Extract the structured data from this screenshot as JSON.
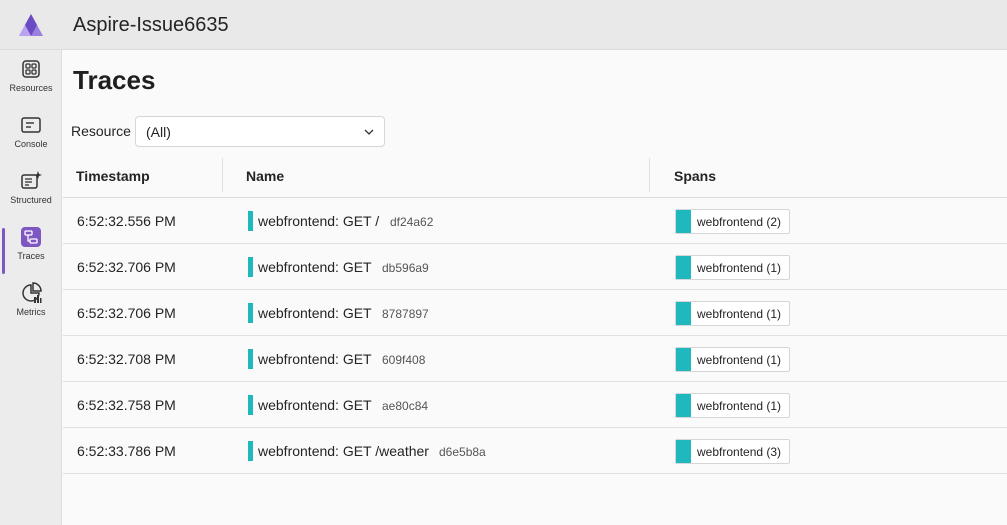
{
  "app": {
    "title": "Aspire-Issue6635",
    "accent": "#7e57c2",
    "span_color": "#1fb8bf"
  },
  "sidebar": {
    "items": [
      {
        "label": "Resources",
        "icon": "grid-icon",
        "active": false
      },
      {
        "label": "Console",
        "icon": "console-icon",
        "active": false
      },
      {
        "label": "Structured",
        "icon": "structured-logs-icon",
        "active": false
      },
      {
        "label": "Traces",
        "icon": "traces-icon",
        "active": true
      },
      {
        "label": "Metrics",
        "icon": "metrics-icon",
        "active": false
      }
    ]
  },
  "page": {
    "title": "Traces"
  },
  "filter": {
    "label": "Resource",
    "selected": "(All)"
  },
  "table": {
    "columns": [
      "Timestamp",
      "Name",
      "Spans"
    ],
    "rows": [
      {
        "timestamp": "6:52:32.556 PM",
        "name": "webfrontend: GET /",
        "trace_id": "df24a62",
        "spans": "webfrontend (2)"
      },
      {
        "timestamp": "6:52:32.706 PM",
        "name": "webfrontend: GET",
        "trace_id": "db596a9",
        "spans": "webfrontend (1)"
      },
      {
        "timestamp": "6:52:32.706 PM",
        "name": "webfrontend: GET",
        "trace_id": "8787897",
        "spans": "webfrontend (1)"
      },
      {
        "timestamp": "6:52:32.708 PM",
        "name": "webfrontend: GET",
        "trace_id": "609f408",
        "spans": "webfrontend (1)"
      },
      {
        "timestamp": "6:52:32.758 PM",
        "name": "webfrontend: GET",
        "trace_id": "ae80c84",
        "spans": "webfrontend (1)"
      },
      {
        "timestamp": "6:52:33.786 PM",
        "name": "webfrontend: GET /weather",
        "trace_id": "d6e5b8a",
        "spans": "webfrontend (3)"
      }
    ]
  }
}
